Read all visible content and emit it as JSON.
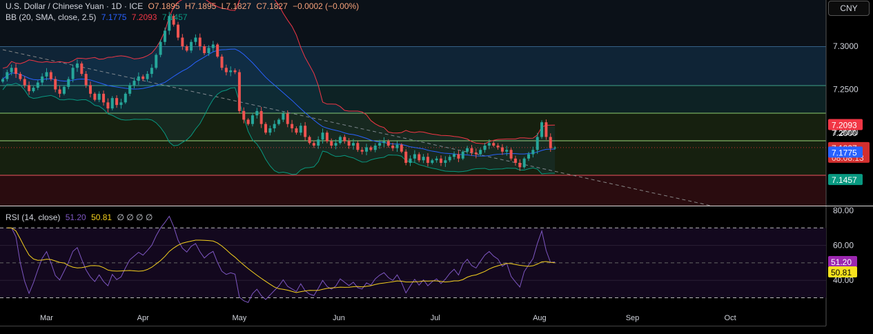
{
  "header": {
    "symbol": "U.S. Dollar / Chinese Yuan · 1D · ICE",
    "open": "O7.1895",
    "high": "H7.1895",
    "low": "L7.1827",
    "close": "C7.1827",
    "change": "−0.0002 (−0.00%)"
  },
  "bb_legend": {
    "label": "BB (20, SMA, close, 2.5)",
    "basis": "7.1775",
    "upper": "7.2093",
    "lower": "7.1457"
  },
  "rsi_legend": {
    "label": "RSI (14, close)",
    "rsi": "51.20",
    "ma": "50.81",
    "extra": "∅ ∅ ∅ ∅"
  },
  "currency_button": "CNY",
  "colors": {
    "up": "#26a69a",
    "down": "#ef5350",
    "bb_basis": "#2962ff",
    "bb_upper": "#f23645",
    "bb_lower": "#089981",
    "rsi": "#7e57c2",
    "rsi_ma": "#f7d21e"
  },
  "chart_data": {
    "type": "candlestick",
    "title": "U.S. Dollar / Chinese Yuan · 1D · ICE",
    "price_axis": {
      "ticks": [
        "7.3000",
        "7.2500",
        "7.2000"
      ],
      "tick_values": [
        7.3,
        7.25,
        7.2
      ],
      "range": [
        7.115,
        7.352
      ]
    },
    "time_axis": {
      "labels": [
        "Mar",
        "Apr",
        "May",
        "Jun",
        "Jul",
        "Aug",
        "Sep",
        "Oct"
      ],
      "label_index": [
        10,
        32,
        54,
        76.7,
        98.7,
        122.5,
        143.7,
        166
      ]
    },
    "closes": [
      7.262,
      7.27,
      7.275,
      7.268,
      7.262,
      7.255,
      7.248,
      7.252,
      7.258,
      7.265,
      7.27,
      7.262,
      7.25,
      7.245,
      7.253,
      7.262,
      7.275,
      7.28,
      7.268,
      7.255,
      7.245,
      7.238,
      7.245,
      7.235,
      7.228,
      7.24,
      7.232,
      7.235,
      7.245,
      7.255,
      7.26,
      7.265,
      7.262,
      7.268,
      7.275,
      7.29,
      7.305,
      7.318,
      7.335,
      7.325,
      7.31,
      7.3,
      7.295,
      7.305,
      7.31,
      7.3,
      7.292,
      7.298,
      7.302,
      7.288,
      7.275,
      7.27,
      7.272,
      7.27,
      7.225,
      7.215,
      7.21,
      7.22,
      7.225,
      7.21,
      7.2,
      7.205,
      7.21,
      7.215,
      7.222,
      7.21,
      7.205,
      7.2,
      7.208,
      7.195,
      7.188,
      7.185,
      7.192,
      7.2,
      7.19,
      7.185,
      7.188,
      7.195,
      7.19,
      7.185,
      7.188,
      7.18,
      7.178,
      7.183,
      7.18,
      7.185,
      7.188,
      7.19,
      7.185,
      7.182,
      7.186,
      7.178,
      7.165,
      7.17,
      7.175,
      7.168,
      7.172,
      7.165,
      7.168,
      7.17,
      7.165,
      7.168,
      7.172,
      7.175,
      7.17,
      7.178,
      7.182,
      7.177,
      7.175,
      7.18,
      7.185,
      7.188,
      7.185,
      7.183,
      7.178,
      7.18,
      7.17,
      7.165,
      7.16,
      7.17,
      7.175,
      7.18,
      7.195,
      7.212,
      7.195,
      7.182,
      7.1827
    ],
    "zones": [
      {
        "from": 7.2545,
        "to": 7.3,
        "color": "#0f2436",
        "line": "#5b9bd5"
      },
      {
        "from": 7.2225,
        "to": 7.2545,
        "color": "#0d2224",
        "line": "#3fa389"
      },
      {
        "from": 7.1506,
        "to": 7.2225,
        "color": "#16200f",
        "line": "#8fcf6f"
      },
      {
        "from": 7.115,
        "to": 7.1506,
        "color": "#2a0c0f",
        "line": "#f05560"
      }
    ],
    "level_line": 7.1906,
    "trendline": {
      "start": [
        0,
        7.296
      ],
      "end": [
        162,
        7.115
      ]
    },
    "bollinger": {
      "period": 20,
      "mult": 2.5
    },
    "price_labels": [
      {
        "value": 7.2093,
        "text": "7.2093",
        "color": "#f23645"
      },
      {
        "value": 7.2,
        "text": "7.2000",
        "color": ""
      },
      {
        "value": 7.1827,
        "text": "7.1827",
        "sub": "08:08:13",
        "color": "#d32f2f"
      },
      {
        "value": 7.1775,
        "text": "7.1775",
        "color": "#2962ff"
      },
      {
        "value": 7.1457,
        "text": "7.1457",
        "color": "#089981"
      }
    ],
    "rsi": {
      "period": 14,
      "ma_period": 14,
      "ticks": [
        "80.00",
        "60.00",
        "40.00"
      ],
      "tick_values": [
        80,
        60,
        40
      ],
      "bands": [
        70,
        50,
        30
      ],
      "range": [
        22,
        83
      ],
      "labels": [
        {
          "value": 51.2,
          "text": "51.20",
          "color": "#9c27b0"
        },
        {
          "value": 45.6,
          "text": "50.81",
          "color": "#f7e21e"
        }
      ]
    }
  }
}
